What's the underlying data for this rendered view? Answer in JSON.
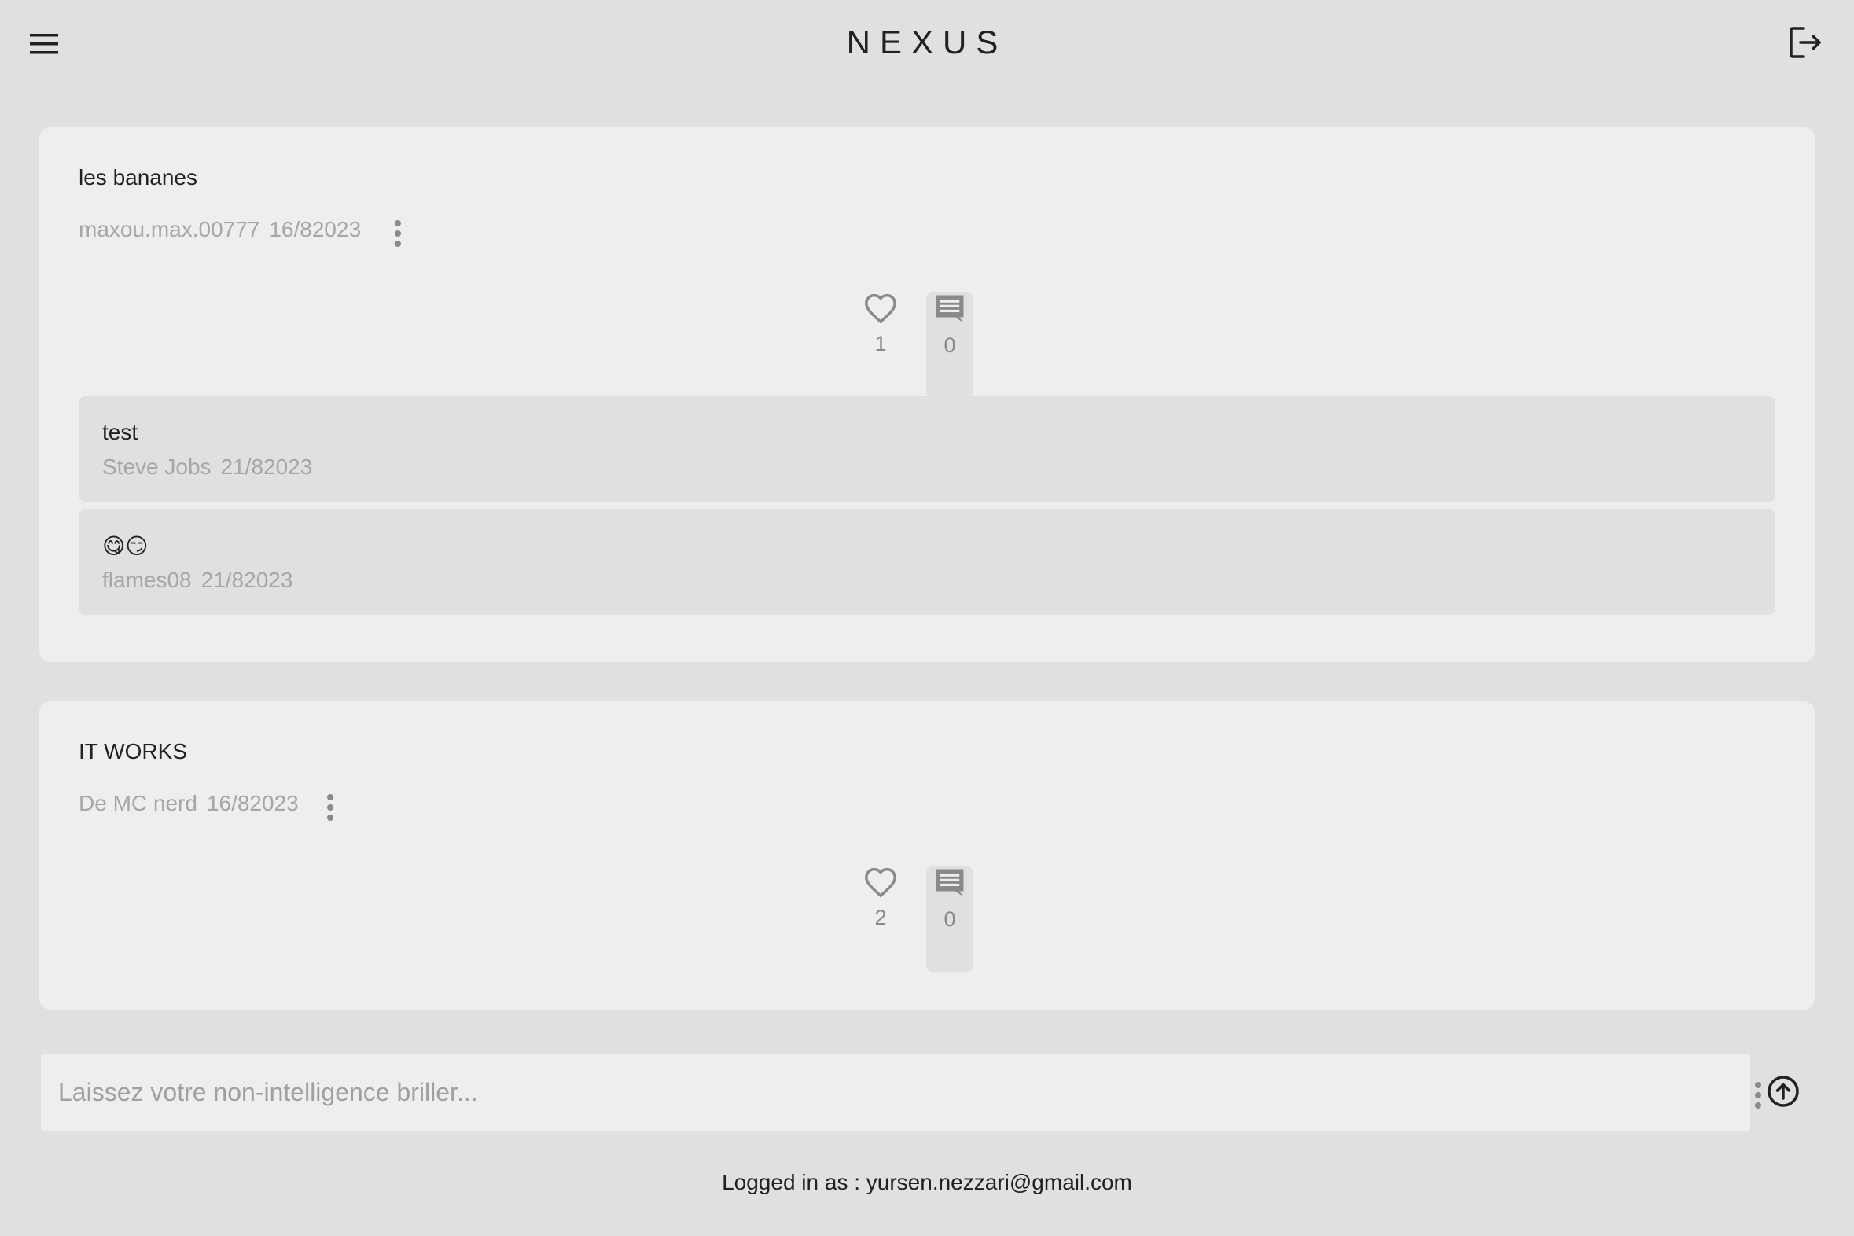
{
  "header": {
    "title": "NEXUS",
    "menu_icon": "hamburger-menu-icon",
    "logout_icon": "logout-icon"
  },
  "posts": [
    {
      "title": "les bananes",
      "author": "maxou.max.00777",
      "date": "16/82023",
      "likes": "1",
      "comments_count": "0",
      "comments": [
        {
          "text": "test",
          "author": "Steve Jobs",
          "date": "21/82023"
        },
        {
          "text": "😋😏",
          "author": "flames08",
          "date": "21/82023"
        }
      ]
    },
    {
      "title": "IT WORKS",
      "author": "De MC nerd",
      "date": "16/82023",
      "likes": "2",
      "comments_count": "0",
      "comments": []
    }
  ],
  "composer": {
    "placeholder": "Laissez votre non-intelligence briller...",
    "value": "",
    "send_icon": "arrow-up-circle-icon"
  },
  "footer": {
    "logged_in": "Logged in as : yursen.nezzari@gmail.com"
  },
  "colors": {
    "background": "#e0e0e0",
    "card": "#eeeeee",
    "comment_bg": "#e0e0e0",
    "muted_text": "#a6a6a6",
    "icon": "#8a8a8a",
    "text": "#212121"
  }
}
